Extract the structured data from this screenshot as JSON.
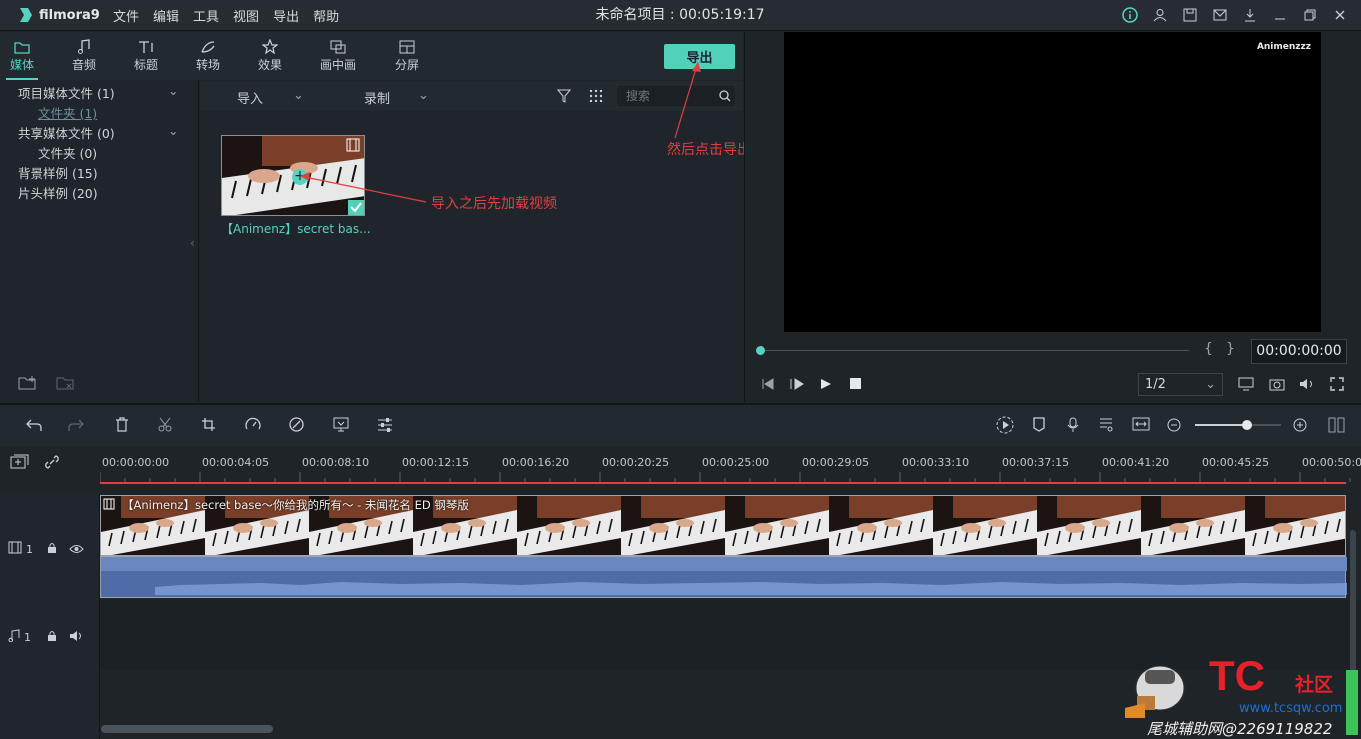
{
  "app": {
    "name": "filmora9",
    "project_title": "未命名项目 : 00:05:19:17"
  },
  "menu": [
    "文件",
    "编辑",
    "工具",
    "视图",
    "导出",
    "帮助"
  ],
  "tabs": [
    {
      "label": "媒体",
      "icon": "folder-icon",
      "active": true
    },
    {
      "label": "音频",
      "icon": "music-note-icon"
    },
    {
      "label": "标题",
      "icon": "title-icon"
    },
    {
      "label": "转场",
      "icon": "transition-icon"
    },
    {
      "label": "效果",
      "icon": "effects-icon"
    },
    {
      "label": "画中画",
      "icon": "pip-icon"
    },
    {
      "label": "分屏",
      "icon": "split-screen-icon"
    }
  ],
  "export_label": "导出",
  "tree": [
    {
      "label": "项目媒体文件 (1)"
    },
    {
      "label": "文件夹 (1)"
    },
    {
      "label": "共享媒体文件 (0)"
    },
    {
      "label": "文件夹 (0)"
    },
    {
      "label": "背景样例 (15)"
    },
    {
      "label": "片头样例 (20)"
    }
  ],
  "subbar": {
    "import": "导入",
    "record": "录制",
    "search_placeholder": "搜索"
  },
  "media_item": {
    "caption": "【Animenz】secret bas..."
  },
  "annotations": {
    "first": "导入之后先加载视频",
    "second": "然后点击导出"
  },
  "preview": {
    "brand": "Animenzzz",
    "timecode": "00:00:00:00",
    "zoom": "1/2"
  },
  "ruler": [
    "00:00:00:00",
    "00:00:04:05",
    "00:00:08:10",
    "00:00:12:15",
    "00:00:16:20",
    "00:00:20:25",
    "00:00:25:00",
    "00:00:29:05",
    "00:00:33:10",
    "00:00:37:15",
    "00:00:41:20",
    "00:00:45:25",
    "00:00:50:0"
  ],
  "clip_title": "【Animenz】secret base～你给我的所有～ - 未闻花名 ED 钢琴版",
  "tracks": {
    "video": "1",
    "audio": "1"
  },
  "watermark": {
    "logo": "TC",
    "sub": "社区",
    "url": "www.tcsqw.com",
    "line": "尾城辅助网@2269119822"
  },
  "colors": {
    "accent": "#57d2c2",
    "export": "#51d1b8",
    "annotation": "#e04040",
    "audio": "#4f6ca8"
  }
}
